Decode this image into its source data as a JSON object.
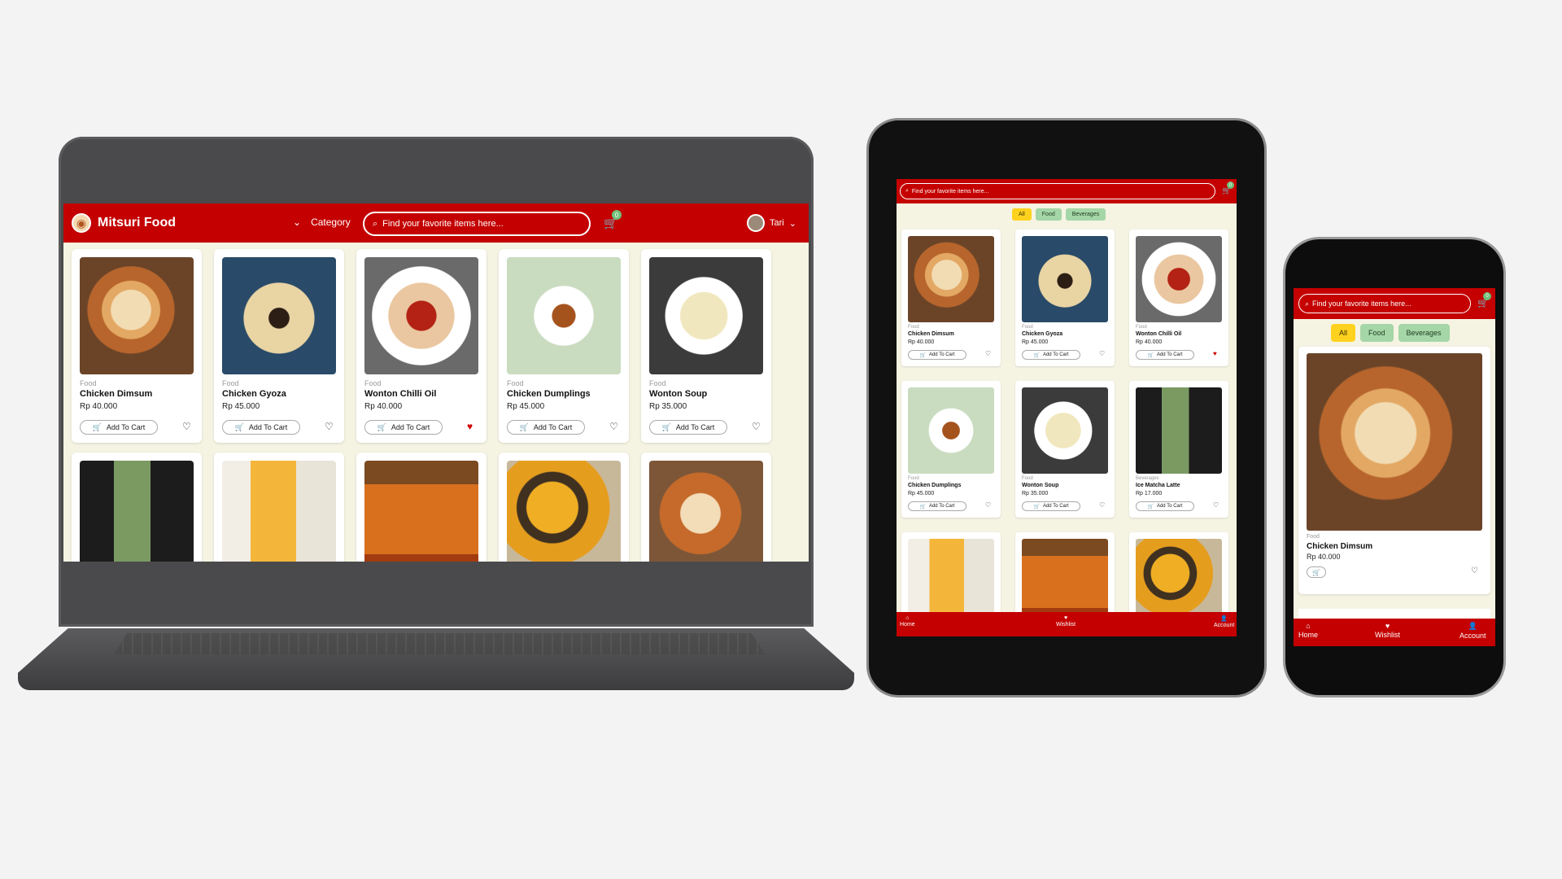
{
  "colors": {
    "brand": "#c40000",
    "background": "#f5f4e3",
    "chip_selected": "#ffd21f",
    "chip": "#a5d6a7",
    "badge": "#6fc07a",
    "wishlist_active": "#d40000"
  },
  "laptop": {
    "brand": "Mitsuri Food",
    "category_label": "Category",
    "search_placeholder": "Find your favorite items here...",
    "cart_count": "0",
    "user_name": "Tari",
    "products": [
      {
        "category": "Food",
        "name": "Chicken Dimsum",
        "price": "Rp 40.000",
        "add": "Add To Cart",
        "wishlisted": false,
        "img": "dim"
      },
      {
        "category": "Food",
        "name": "Chicken Gyoza",
        "price": "Rp 45.000",
        "add": "Add To Cart",
        "wishlisted": false,
        "img": "gyo"
      },
      {
        "category": "Food",
        "name": "Wonton Chilli Oil",
        "price": "Rp 40.000",
        "add": "Add To Cart",
        "wishlisted": true,
        "img": "won"
      },
      {
        "category": "Food",
        "name": "Chicken Dumplings",
        "price": "Rp 45.000",
        "add": "Add To Cart",
        "wishlisted": false,
        "img": "dum"
      },
      {
        "category": "Food",
        "name": "Wonton Soup",
        "price": "Rp 35.000",
        "add": "Add To Cart",
        "wishlisted": false,
        "img": "soup"
      }
    ],
    "second_row_images": [
      "mat",
      "ora",
      "tea",
      "yel",
      "bun"
    ]
  },
  "tablet": {
    "search_placeholder": "Find your favorite items here...",
    "cart_count": "0",
    "filters": [
      "All",
      "Food",
      "Beverages"
    ],
    "selected_filter": "All",
    "products": [
      {
        "category": "Food",
        "name": "Chicken Dimsum",
        "price": "Rp 40.000",
        "add": "Add To Cart",
        "wishlisted": false,
        "img": "dim"
      },
      {
        "category": "Food",
        "name": "Chicken Gyoza",
        "price": "Rp 45.000",
        "add": "Add To Cart",
        "wishlisted": false,
        "img": "gyo"
      },
      {
        "category": "Food",
        "name": "Wonton Chilli Oil",
        "price": "Rp 40.000",
        "add": "Add To Cart",
        "wishlisted": true,
        "img": "won"
      },
      {
        "category": "Food",
        "name": "Chicken Dumplings",
        "price": "Rp 45.000",
        "add": "Add To Cart",
        "wishlisted": false,
        "img": "dum"
      },
      {
        "category": "Food",
        "name": "Wonton Soup",
        "price": "Rp 35.000",
        "add": "Add To Cart",
        "wishlisted": false,
        "img": "soup"
      },
      {
        "category": "Beverages",
        "name": "Ice Matcha Latte",
        "price": "Rp 17.000",
        "add": "Add To Cart",
        "wishlisted": false,
        "img": "mat"
      }
    ],
    "third_row_images": [
      "ora",
      "tea",
      "yel"
    ],
    "nav": [
      "Home",
      "Wishlist",
      "Account"
    ]
  },
  "phone": {
    "search_placeholder": "Find your favorite items here...",
    "cart_count": "0",
    "filters": [
      "All",
      "Food",
      "Beverages"
    ],
    "selected_filter": "All",
    "product": {
      "category": "Food",
      "name": "Chicken Dimsum",
      "price": "Rp 40.000",
      "wishlisted": false,
      "img": "dim"
    },
    "nav": [
      "Home",
      "Wishlist",
      "Account"
    ]
  }
}
